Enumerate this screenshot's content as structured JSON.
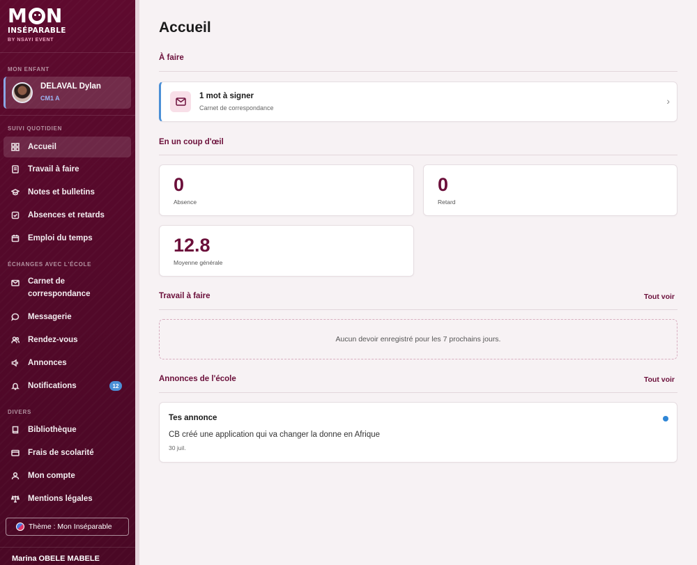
{
  "brand": {
    "line1": "MON",
    "line2": "INSÉPARABLE",
    "by": "BY NSAYI EVENT"
  },
  "sidebar": {
    "section_child": "MON ENFANT",
    "child": {
      "name": "DELAVAL Dylan",
      "class": "CM1 A"
    },
    "section_daily": "SUIVI QUOTIDIEN",
    "daily_items": [
      {
        "label": "Accueil",
        "icon": "dashboard-icon"
      },
      {
        "label": "Travail à faire",
        "icon": "homework-icon"
      },
      {
        "label": "Notes et bulletins",
        "icon": "graduation-cap-icon"
      },
      {
        "label": "Absences et retards",
        "icon": "checkbox-icon"
      },
      {
        "label": "Emploi du temps",
        "icon": "calendar-icon"
      }
    ],
    "section_exchange": "ÉCHANGES AVEC L'ÉCOLE",
    "exchange_items": [
      {
        "label": "Carnet de correspondance",
        "icon": "mail-icon"
      },
      {
        "label": "Messagerie",
        "icon": "chat-icon"
      },
      {
        "label": "Rendez-vous",
        "icon": "users-icon"
      },
      {
        "label": "Annonces",
        "icon": "megaphone-icon"
      },
      {
        "label": "Notifications",
        "icon": "bell-icon",
        "badge": "12"
      }
    ],
    "section_misc": "DIVERS",
    "misc_items": [
      {
        "label": "Bibliothèque",
        "icon": "book-icon"
      },
      {
        "label": "Frais de scolarité",
        "icon": "credit-card-icon"
      },
      {
        "label": "Mon compte",
        "icon": "user-icon"
      },
      {
        "label": "Mentions légales",
        "icon": "scale-icon"
      }
    ],
    "theme_label": "Thème : Mon Inséparable",
    "user_name": "Marina OBELE MABELE"
  },
  "main": {
    "title": "Accueil",
    "todo": {
      "heading": "À faire",
      "item_title": "1 mot à signer",
      "item_subtitle": "Carnet de correspondance"
    },
    "glance": {
      "heading": "En un coup d'œil",
      "absence_value": "0",
      "absence_label": "Absence",
      "retard_value": "0",
      "retard_label": "Retard",
      "moyenne_value": "12.8",
      "moyenne_label": "Moyenne générale"
    },
    "homework": {
      "heading": "Travail à faire",
      "see_all": "Tout voir",
      "empty": "Aucun devoir enregistré pour les 7 prochains jours."
    },
    "announcements": {
      "heading": "Annonces de l'école",
      "see_all": "Tout voir",
      "item_title": "Tes annonce",
      "item_text": "CB créé une application qui va changer la donne en Afrique",
      "item_date": "30 juil."
    }
  },
  "colors": {
    "sidebar": "#5e0a2e",
    "accent": "#6b0f3a",
    "badge": "#4a8fd6",
    "background": "#f7f2f4"
  }
}
